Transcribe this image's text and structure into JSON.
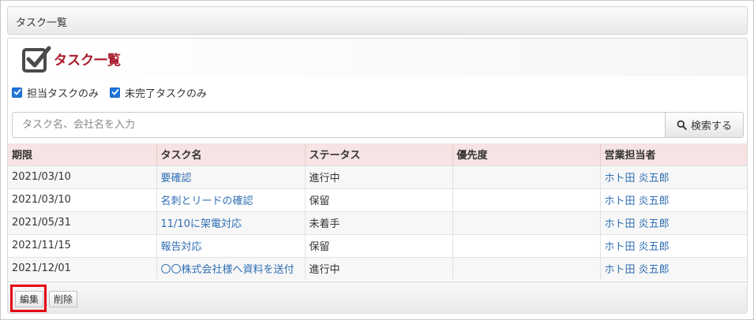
{
  "page": {
    "header_title": "タスク一覧"
  },
  "panel": {
    "title": "タスク一覧",
    "filters": [
      {
        "label": "担当タスクのみ",
        "checked": true
      },
      {
        "label": "未完了タスクのみ",
        "checked": true
      }
    ],
    "search": {
      "placeholder": "タスク名、会社名を入力",
      "value": "",
      "button_label": "検索する"
    }
  },
  "table": {
    "columns": [
      "期限",
      "タスク名",
      "ステータス",
      "優先度",
      "営業担当者"
    ],
    "rows": [
      {
        "due": "2021/03/10",
        "task": "要確認",
        "status": "進行中",
        "priority": "",
        "owner": "ホト田 炎五郎"
      },
      {
        "due": "2021/03/10",
        "task": "名刺とリードの確認",
        "status": "保留",
        "priority": "",
        "owner": "ホト田 炎五郎"
      },
      {
        "due": "2021/05/31",
        "task": "11/10に架電対応",
        "status": "未着手",
        "priority": "",
        "owner": "ホト田 炎五郎"
      },
      {
        "due": "2021/11/15",
        "task": "報告対応",
        "status": "保留",
        "priority": "",
        "owner": "ホト田 炎五郎"
      },
      {
        "due": "2021/12/01",
        "task": "〇〇株式会社様へ資料を送付",
        "status": "進行中",
        "priority": "",
        "owner": "ホト田 炎五郎"
      }
    ]
  },
  "footer": {
    "edit_label": "編集",
    "delete_label": "削除"
  },
  "colors": {
    "title_accent": "#a8192a",
    "link": "#2f6fb4",
    "header_row_bg": "#f6e3e3",
    "highlight_border": "#e50012",
    "checkbox": "#1f74d8"
  },
  "icons": {
    "title": "checkbox-check-icon",
    "search": "search-icon",
    "filter_checkbox": "checkmark-icon"
  }
}
